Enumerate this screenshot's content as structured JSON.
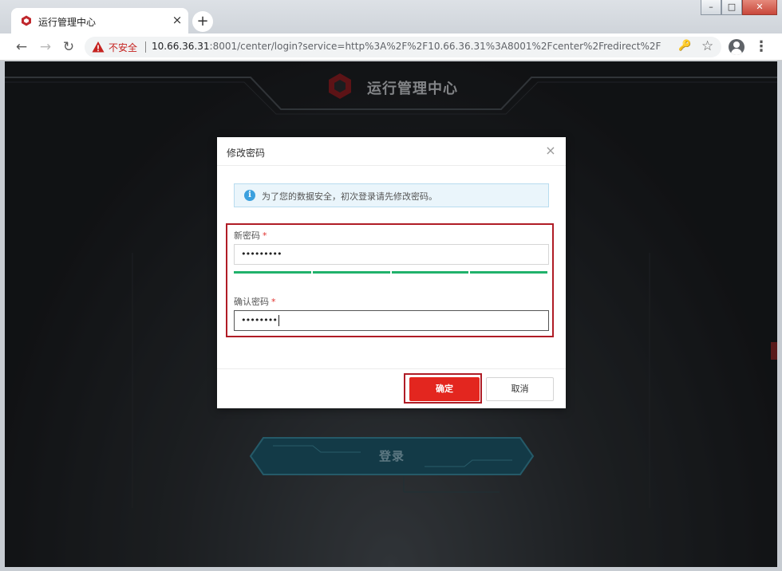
{
  "browser": {
    "tab_title": "运行管理中心",
    "tab_close": "×",
    "new_tab": "+",
    "window_buttons": {
      "minimize": "–",
      "maximize": "□",
      "close": "✕"
    },
    "nav": {
      "back": "←",
      "forward": "→",
      "reload": "↻"
    },
    "address": {
      "security_label": "不安全",
      "host": "10.66.36.31",
      "rest": ":8001/center/login?service=http%3A%2F%2F10.66.36.31%3A8001%2Fcenter%2Fredirect%2F"
    },
    "icons": {
      "key": "🔑",
      "star": "☆",
      "menu": "⋮"
    }
  },
  "page": {
    "header_title": "运行管理中心",
    "login_button": "登录",
    "brand_color": "#c0282d"
  },
  "dialog": {
    "title": "修改密码",
    "close": "×",
    "notice": "为了您的数据安全，初次登录请先修改密码。",
    "new_password": {
      "label": "新密码",
      "required": "*",
      "value": "•••••••••"
    },
    "strength_segments": 4,
    "strength_color": "#20b26b",
    "confirm_password": {
      "label": "确认密码",
      "required": "*",
      "value": "••••••••"
    },
    "ok_label": "确定",
    "cancel_label": "取消"
  }
}
